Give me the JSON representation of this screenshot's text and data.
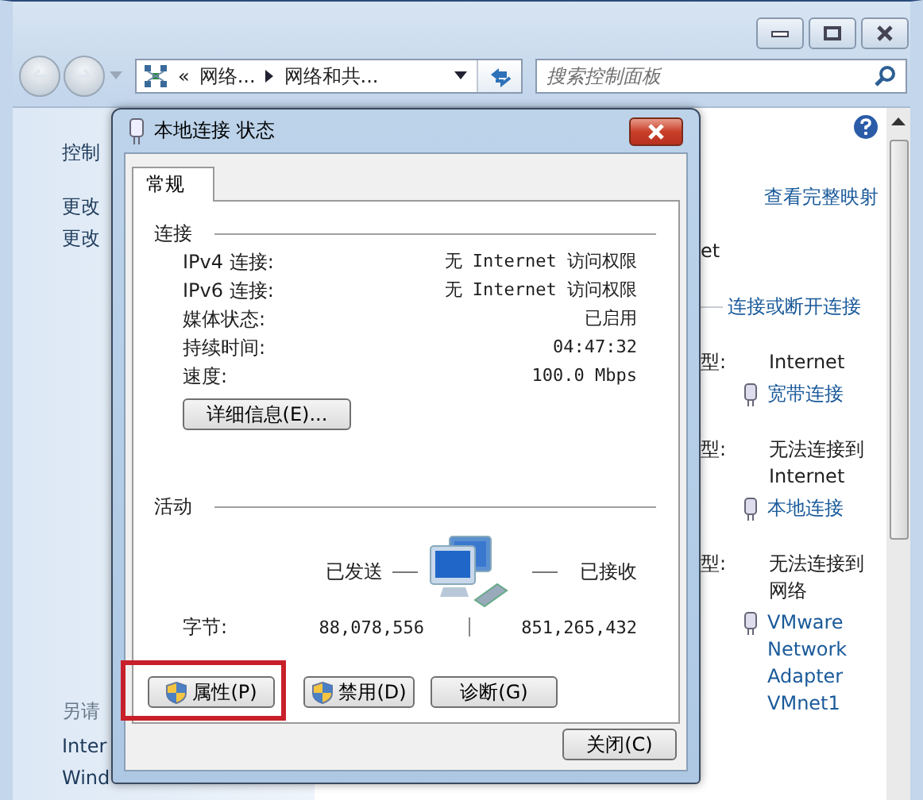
{
  "explorer": {
    "breadcrumb": {
      "overflow": "«",
      "crumbs": [
        "网络...",
        "网络和共..."
      ]
    },
    "search": {
      "placeholder": "搜索控制面板"
    },
    "sidebar": {
      "items": [
        "控制",
        "更改",
        "更改"
      ],
      "see_also_label": "另请",
      "see_also": [
        "Inter",
        "Wind"
      ]
    },
    "main": {
      "map_link": "查看完整映射",
      "cut_text": "et",
      "connect_link": "连接或断开连接",
      "networks": [
        {
          "type_label": "型:",
          "value": "Internet",
          "links": [
            "宽带连接"
          ]
        },
        {
          "type_label": "型:",
          "value": "无法连接到 Internet",
          "links": [
            "本地连接"
          ]
        },
        {
          "type_label": "型:",
          "value": "无法连接到网络",
          "links": [
            "VMware Network Adapter VMnet1"
          ]
        }
      ]
    }
  },
  "dialog": {
    "title": "本地连接 状态",
    "tabs": [
      {
        "label": "常规",
        "selected": true
      }
    ],
    "connection": {
      "heading": "连接",
      "rows": [
        {
          "label": "IPv4 连接:",
          "value": "无 Internet 访问权限"
        },
        {
          "label": "IPv6 连接:",
          "value": "无 Internet 访问权限"
        },
        {
          "label": "媒体状态:",
          "value": "已启用"
        },
        {
          "label": "持续时间:",
          "value": "04:47:32"
        },
        {
          "label": "速度:",
          "value": "100.0 Mbps"
        }
      ],
      "details_button": "详细信息(E)..."
    },
    "activity": {
      "heading": "活动",
      "sent_label": "已发送",
      "received_label": "已接收",
      "bytes_label": "字节:",
      "sent": "88,078,556",
      "received": "851,265,432"
    },
    "buttons": [
      {
        "label": "属性(P)",
        "shield": true,
        "highlighted": true
      },
      {
        "label": "禁用(D)",
        "shield": true,
        "highlighted": false
      },
      {
        "label": "诊断(G)",
        "shield": false,
        "highlighted": false
      }
    ],
    "close_button": "关闭(C)"
  }
}
